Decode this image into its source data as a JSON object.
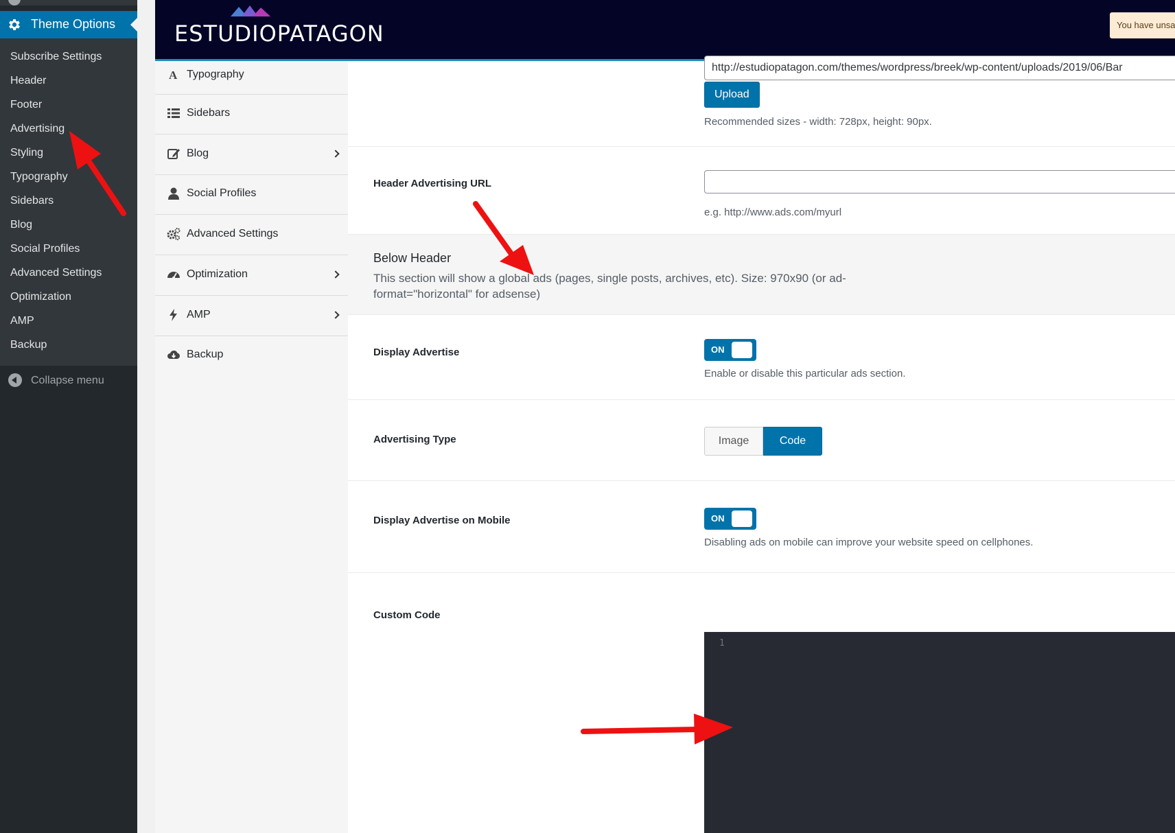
{
  "wp_menu": {
    "current": "Theme Options",
    "submenu": [
      "Subscribe Settings",
      "Header",
      "Footer",
      "Advertising",
      "Styling",
      "Typography",
      "Sidebars",
      "Blog",
      "Social Profiles",
      "Advanced Settings",
      "Optimization",
      "AMP",
      "Backup"
    ],
    "collapse_label": "Collapse menu"
  },
  "header": {
    "logo_text": "ESTUDIOPATAGON",
    "notice_text": "You have unsa"
  },
  "options_menu": {
    "items": [
      {
        "label": "Typography",
        "icon": "font-icon",
        "has_children": false
      },
      {
        "label": "Sidebars",
        "icon": "list-icon",
        "has_children": false
      },
      {
        "label": "Blog",
        "icon": "edit-icon",
        "has_children": true
      },
      {
        "label": "Social Profiles",
        "icon": "user-icon",
        "has_children": false
      },
      {
        "label": "Advanced Settings",
        "icon": "cogs-icon",
        "has_children": false
      },
      {
        "label": "Optimization",
        "icon": "gauge-icon",
        "has_children": true
      },
      {
        "label": "AMP",
        "icon": "bolt-icon",
        "has_children": true
      },
      {
        "label": "Backup",
        "icon": "cloud-download-icon",
        "has_children": false
      }
    ]
  },
  "content": {
    "banner_url_value": "http://estudiopatagon.com/themes/wordpress/breek/wp-content/uploads/2019/06/Bar",
    "upload_label": "Upload",
    "recommended_sizes": "Recommended sizes - width: 728px, height: 90px.",
    "header_ad_url_label": "Header Advertising URL",
    "header_ad_url_value": "",
    "header_ad_url_hint": "e.g. http://www.ads.com/myurl",
    "below_header_title": "Below Header",
    "below_header_desc": "This section will show a global ads (pages, single posts, archives, etc). Size: 970x90 (or ad-format=\"horizontal\" for adsense)",
    "display_advertise_label": "Display Advertise",
    "display_advertise_state": "ON",
    "display_advertise_hint": "Enable or disable this particular ads section.",
    "advertising_type_label": "Advertising Type",
    "advertising_type_options": [
      "Image",
      "Code"
    ],
    "advertising_type_selected": "Code",
    "display_mobile_label": "Display Advertise on Mobile",
    "display_mobile_state": "ON",
    "display_mobile_hint": "Disabling ads on mobile can improve your website speed on cellphones.",
    "custom_code_label": "Custom Code",
    "code_line_number": "1"
  },
  "colors": {
    "wp_sidebar": "#23282d",
    "wp_accent": "#0073aa",
    "header_bg": "#030426",
    "editor_bg": "#272a33",
    "annotation_arrow": "#ee1111"
  }
}
